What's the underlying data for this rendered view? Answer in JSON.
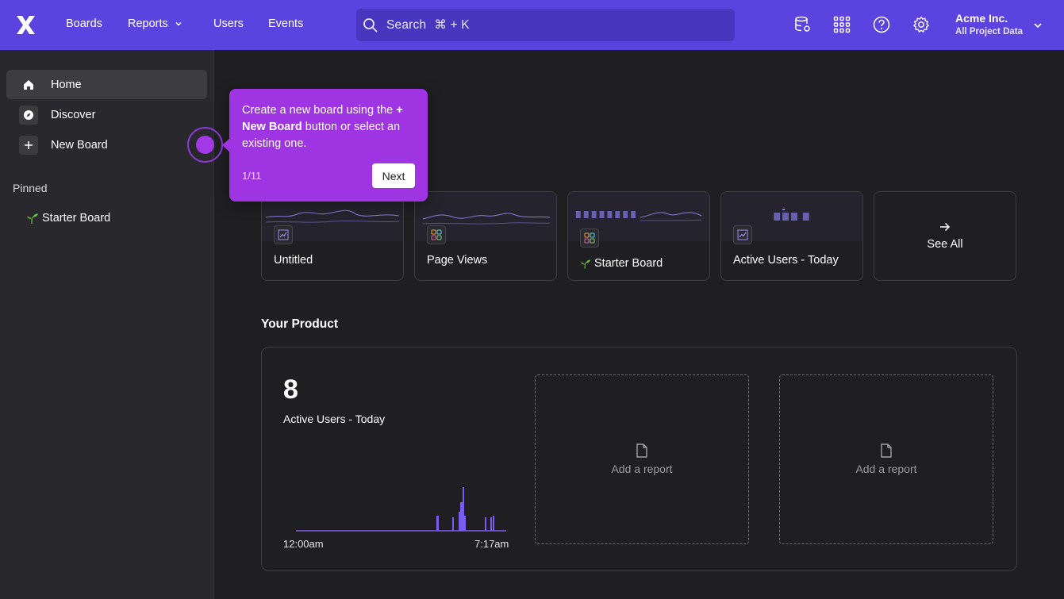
{
  "topbar": {
    "nav": [
      {
        "label": "Boards"
      },
      {
        "label": "Reports"
      },
      {
        "label": "Users"
      },
      {
        "label": "Events"
      }
    ],
    "search_label": "Search",
    "search_shortcut": "⌘ + K",
    "org_name": "Acme Inc.",
    "org_scope": "All Project Data"
  },
  "sidebar": {
    "items": [
      {
        "label": "Home",
        "icon": "home-icon",
        "active": true
      },
      {
        "label": "Discover",
        "icon": "compass-icon",
        "active": false
      },
      {
        "label": "New Board",
        "icon": "plus-icon",
        "active": false
      }
    ],
    "pinned_heading": "Pinned",
    "pinned": [
      {
        "label": "Starter Board",
        "icon": "sprout-icon"
      }
    ]
  },
  "tour": {
    "text_before": "Create a new board using the",
    "text_bold": "+ New Board",
    "text_after": "button or select an existing one.",
    "step": "1/11",
    "next_label": "Next"
  },
  "boards": [
    {
      "label": "Untitled",
      "icon": "line-chart-icon"
    },
    {
      "label": "Page Views",
      "icon": "grid-icon"
    },
    {
      "label": "Starter Board",
      "icon": "grid-icon",
      "emoji": "sprout-icon"
    },
    {
      "label": "Active Users - Today",
      "icon": "line-chart-icon"
    },
    {
      "label": "See All",
      "icon": "arrow-right-icon"
    }
  ],
  "product": {
    "title": "Your Product",
    "metric_value": "8",
    "metric_label": "Active Users - Today",
    "x_start": "12:00am",
    "x_end": "7:17am",
    "slots": [
      {
        "label": "Add a report"
      },
      {
        "label": "Add a report"
      }
    ]
  },
  "colors": {
    "topbar": "#5b43df",
    "sidebar": "#29292d",
    "background": "#1f1f21",
    "tour": "#9f35e2",
    "accent": "#7b5cf0"
  }
}
